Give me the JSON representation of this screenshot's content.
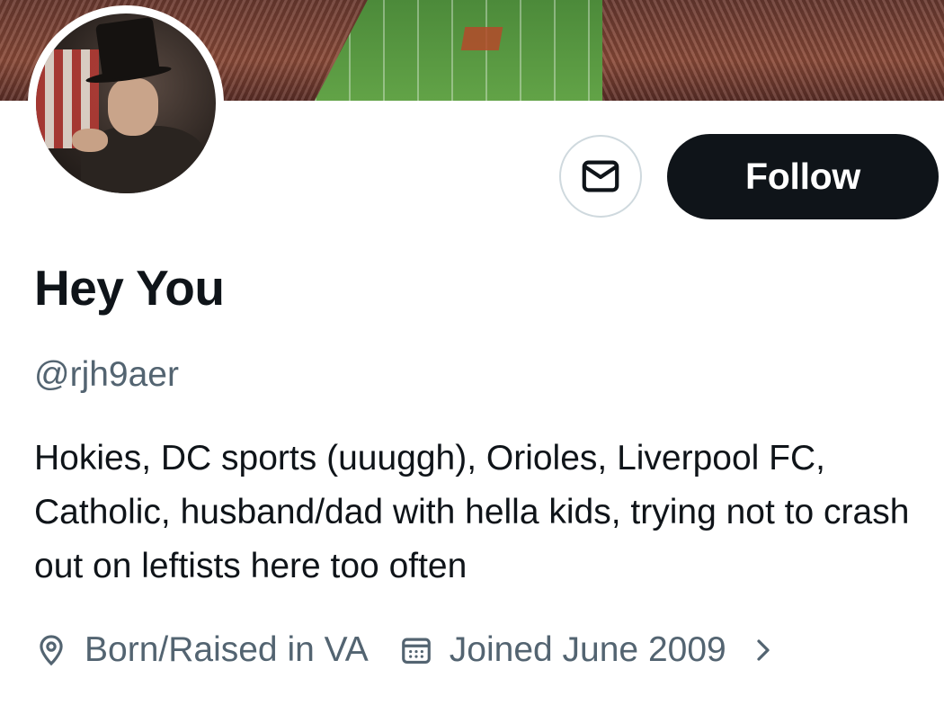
{
  "profile": {
    "display_name": "Hey You",
    "handle": "@rjh9aer",
    "bio": "Hokies, DC sports (uuuggh), Orioles, Liverpool FC, Catholic, husband/dad with hella kids, trying not to crash out on leftists here too often",
    "location": "Born/Raised in VA",
    "joined": "Joined June 2009"
  },
  "actions": {
    "follow_label": "Follow"
  },
  "icons": {
    "message": "envelope-icon",
    "location": "location-pin-icon",
    "joined": "calendar-icon",
    "more": "chevron-right-icon"
  },
  "colors": {
    "primary_text": "#0f1419",
    "secondary_text": "#536471",
    "follow_bg": "#0f1419",
    "border": "#cfd9de"
  }
}
